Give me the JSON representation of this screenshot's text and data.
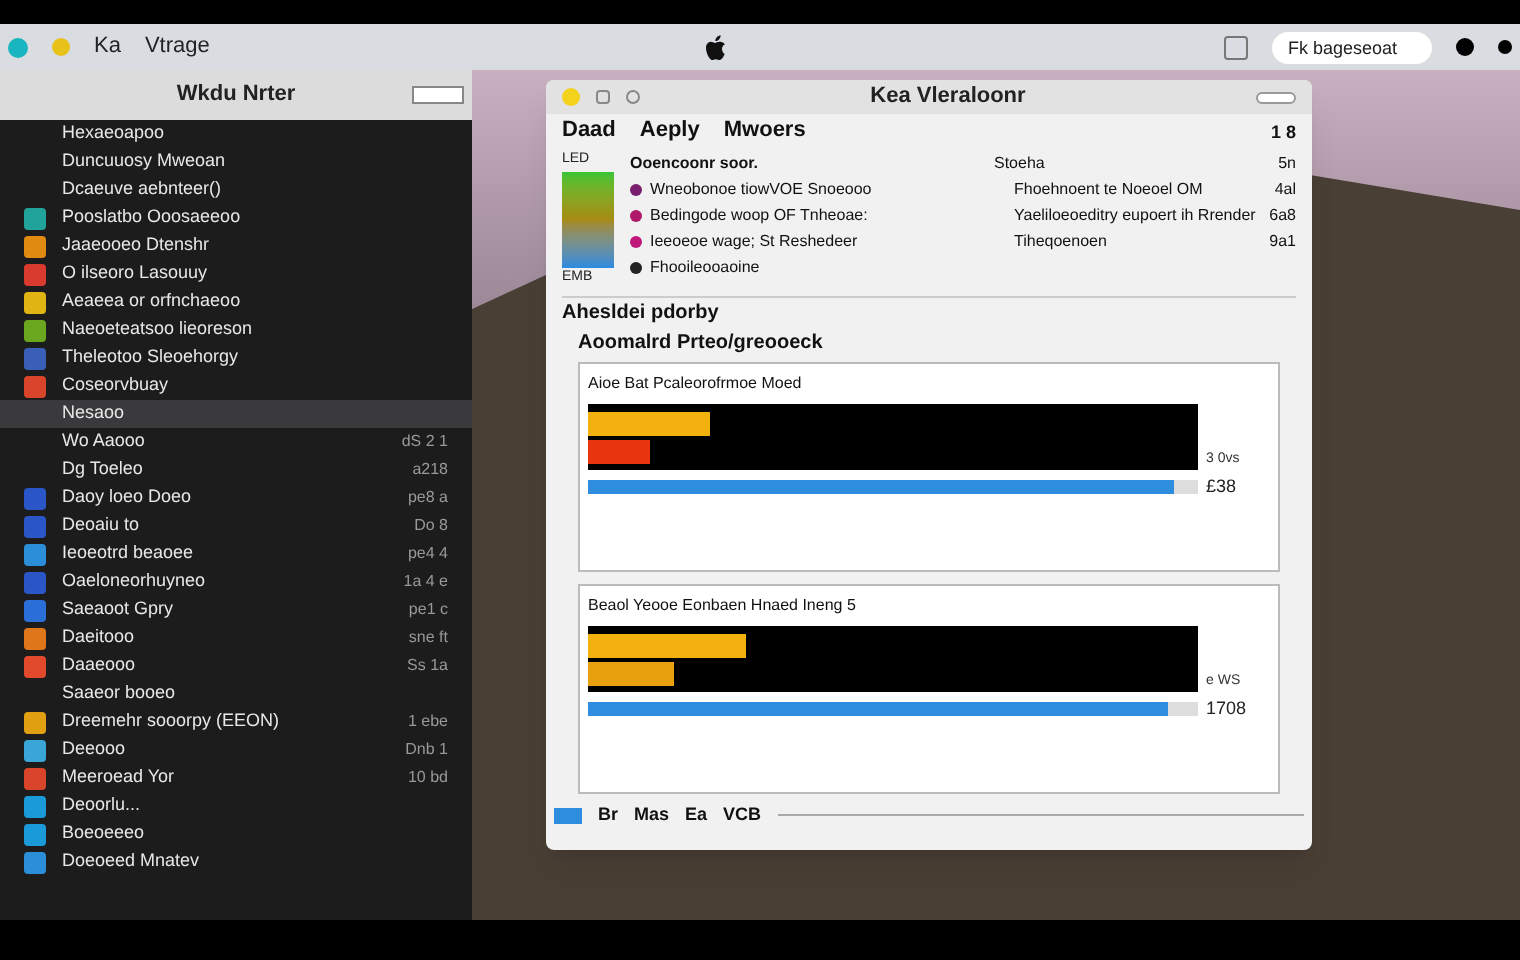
{
  "menubar": {
    "items": [
      "Ka",
      "Vtrage"
    ],
    "search": {
      "placeholder": "Fk bageseoat"
    }
  },
  "sidebar": {
    "title": "Wkdu Nrter",
    "items": [
      {
        "name": "Hexaeoapoo",
        "selected": false
      },
      {
        "name": "Duncuuosy Mweoan",
        "selected": false
      },
      {
        "name": "Dcaeuve aebnteer()",
        "selected": false
      },
      {
        "name": "Pooslatbo Ooosaeeoo",
        "color": "#1fa39a",
        "selected": false
      },
      {
        "name": "Jaaeooeo Dtenshr",
        "color": "#e08a12",
        "selected": false
      },
      {
        "name": "O ilseoro Lasouuy",
        "color": "#d83a2e",
        "selected": false
      },
      {
        "name": "Aeaeea or orfnchaeoo",
        "color": "#e0b412",
        "selected": false
      },
      {
        "name": "Naeoeteatsoo lieoreson",
        "color": "#6aa71e",
        "selected": false
      },
      {
        "name": "Theleotoo Sleoehorgy",
        "color": "#3a5fb8",
        "selected": false
      },
      {
        "name": "Coseorvbuay",
        "color": "#d8452a",
        "selected": false
      },
      {
        "name": "Nesaoo",
        "selected": true
      },
      {
        "name": "Wo Aaooo",
        "value": "dS 2 1",
        "selected": false
      },
      {
        "name": "Dg Toeleo",
        "value": "a218",
        "selected": false
      },
      {
        "name": "Daoy loeo Doeo",
        "value": "pe8 a",
        "color": "#2a56c8",
        "selected": false
      },
      {
        "name": "Deoaiu to",
        "value": "Do 8",
        "color": "#2a56c8",
        "selected": false
      },
      {
        "name": "Ieoeotrd beaoee",
        "value": "pe4 4",
        "color": "#2a8fd8",
        "selected": false
      },
      {
        "name": "Oaeloneorhuyneo",
        "value": "1a 4 e",
        "color": "#2a56c8",
        "selected": false
      },
      {
        "name": "Saeaoot Gpry",
        "value": "pe1 c",
        "color": "#2a6fd8",
        "selected": false
      },
      {
        "name": "Daeitooo",
        "value": "sne ft",
        "color": "#e0761a",
        "selected": false
      },
      {
        "name": "Daaeooo",
        "value": "Ss 1a",
        "color": "#e04a2a",
        "selected": false
      },
      {
        "name": "Saaeor booeo",
        "selected": false
      },
      {
        "name": "Dreemehr sooorpy (EEON)",
        "value": "1 ebe",
        "color": "#e0a012",
        "selected": false
      },
      {
        "name": "Deeooo",
        "value": "Dnb 1",
        "color": "#3aa6d8",
        "selected": false
      },
      {
        "name": "Meeroead Yor",
        "value": "10 bd",
        "color": "#d8452a",
        "selected": false
      },
      {
        "name": "Deoorlu...",
        "color": "#1a9ad8",
        "selected": false
      },
      {
        "name": "Boeoeeeo",
        "color": "#1a9ad8",
        "selected": false
      },
      {
        "name": "Doeoeed Mnatev",
        "color": "#2a8fd8",
        "selected": false
      }
    ]
  },
  "window": {
    "title": "Kea Vleraloonr",
    "columns": [
      "Daad",
      "Aeply",
      "Mwoers"
    ],
    "column_4": "1 8",
    "legend": {
      "top": "LED",
      "bottom": "EMB"
    },
    "rows": [
      {
        "kind": "header",
        "name": "Ooencoonr soor.",
        "detail": "Stoeha",
        "value": "5n"
      },
      {
        "kind": "dot",
        "name": "Wneobonoe tiowVOE Snoeooo",
        "detail": "Fhoehnoent te Noeoel OM",
        "value": "4al",
        "color": "#7a1e6e"
      },
      {
        "kind": "dot",
        "name": "Bedingode woop OF Tnheoae:",
        "detail": "Yaeliloeoeditry eupoert ih Rrender",
        "value": "6a8",
        "color": "#b0186a"
      },
      {
        "kind": "dot",
        "name": "Ieeoeoe wage; St Reshedeer",
        "detail": "Tiheqoenoen",
        "value": "9a1",
        "color": "#c0187a"
      },
      {
        "kind": "dot",
        "name": "Fhooileooaoine",
        "color": "#222222"
      }
    ],
    "section": "Ahesldei pdorby",
    "group": "Aoomalrd Prteo/greooeck",
    "panels": [
      {
        "title": "Aioe Bat Pcaleorofrmoe Moed",
        "bars": [
          {
            "color": "#f2b10f",
            "level": 0.2
          },
          {
            "color": "#e8350f",
            "level": 0.1
          }
        ],
        "level": 0.96,
        "reading_1": "3 0vs",
        "reading_2": "£38"
      },
      {
        "title": "Beaol Yeooe Eonbaen Hnaed Ineng 5",
        "bars": [
          {
            "color": "#f2b10f",
            "level": 0.26
          },
          {
            "color": "#e8a00f",
            "level": 0.14
          }
        ],
        "level": 0.95,
        "reading_1": "e WS",
        "reading_2": "1708"
      }
    ],
    "status": [
      "Br",
      "Mas",
      "Ea",
      "VCB"
    ]
  }
}
